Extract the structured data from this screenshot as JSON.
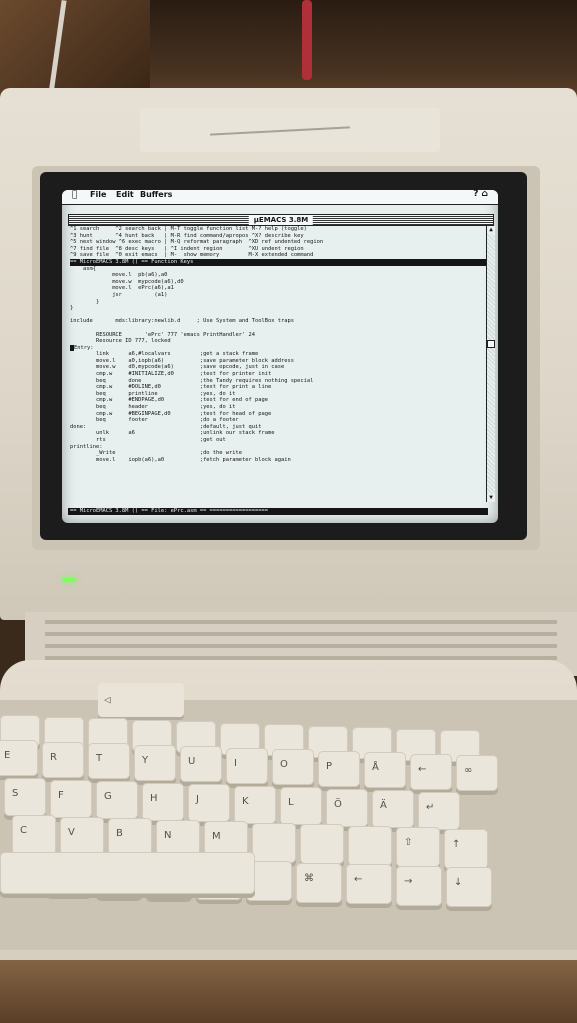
{
  "menubar": {
    "apple": "",
    "items": [
      "File",
      "Edit",
      "Buffers"
    ],
    "right_icons": "?  ⌂"
  },
  "window": {
    "title": "μEMACS 3.8M"
  },
  "help_lines": [
    "^1 search     ^2 search back | M-T toggle function list M-? help (toggle)",
    "^3 hunt       ^4 hunt back   | M-R find command/apropos ^X? describe key",
    "^5 next window ^6 exec macro | M-Q reformat paragraph  ^XD ref undented region",
    "^7 find file  ^8 desc keys   | ^I indent region        ^XU undent region",
    "^9 save file  ^0 exit emacs  | M-  show memory         M-X extended command"
  ],
  "modeline_top": "== MicroEMACS 3.8M () == Function Keys",
  "code_lines": [
    "    asm{",
    "             move.l  pb(a6),a0",
    "             move.w  mypcode(a6),d0",
    "             move.l  ePrc(a6),a1",
    "             jsr          (a1)",
    "        }",
    "}",
    "",
    "include       mds:library:newlib.d     ; Use System and ToolBox traps",
    "",
    "        RESOURCE       'ePrc' 777 'emacs PrintHandler' 24",
    "        Resource ID 777, locked",
    "Entry:",
    "        link      a6,#localvars         ;get a stack frame",
    "        move.l    a0,iopb(a6)           ;save parameter block address",
    "        move.w    d0,mypcode(a6)        ;save opcode, just in case",
    "        cmp.w     #INITIALIZE,d0        ;test for printer init",
    "        beq       done                  ;the Tandy requires nothing special",
    "        cmp.w     #DOLINE,d0            ;test for print a line",
    "        beq       printline             ;yes, do it",
    "        cmp.w     #ENDPAGE,d0           ;test for end of page",
    "        beq       header                ;yes, do it",
    "        cmp.w     #BEGINPAGE,d0         ;test for head of page",
    "        beq       footer                ;do a footer",
    "done:                                   ;default, just quit",
    "        unlk      a6                    ;unlink our stack frame",
    "        rts                             ;get out",
    "printline:",
    "        _Write                          ;do the write",
    "        move.l    iopb(a6),a0           ;fetch parameter block again"
  ],
  "modeline_bottom": "== MicroEMACS 3.8M () == File: ePrc.asm == ==================",
  "keyboard": {
    "power_key": "◁",
    "keys": [
      "E",
      "R",
      "T",
      "Y",
      "U",
      "I",
      "O",
      "P",
      "Å",
      "←",
      "∞",
      "S",
      "F",
      "G",
      "H",
      "J",
      "K",
      "L",
      "Ö",
      "Ä",
      "↵",
      "C",
      "V",
      "B",
      "N",
      "M",
      "",
      "",
      "",
      "⇧",
      "⌘",
      "←",
      "→",
      "↓",
      "↑"
    ]
  }
}
